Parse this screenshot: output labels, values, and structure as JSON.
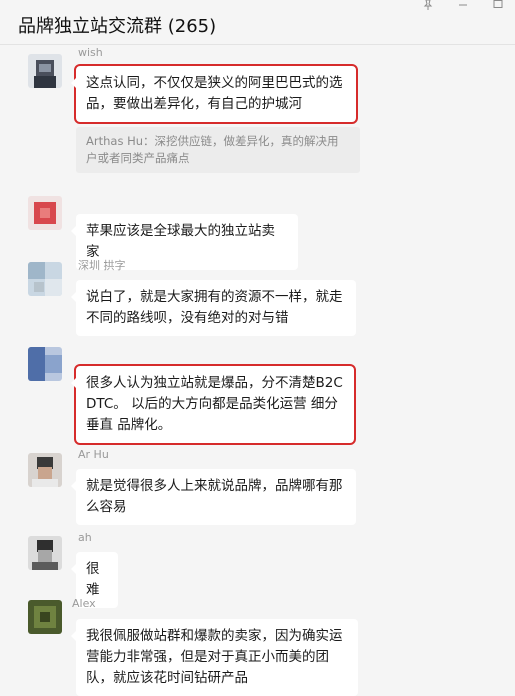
{
  "header": {
    "title": "品牌独立站交流群 (265)"
  },
  "window_controls": {
    "pin_icon": "pin-icon",
    "minimize_icon": "minimize-icon",
    "maximize_icon": "maximize-icon"
  },
  "messages": [
    {
      "sender": "wish",
      "text": "这点认同，不仅仅是狭义的阿里巴巴式的选品，要做出差异化，有自己的护城河",
      "highlighted": true,
      "quote": "Arthas Hu：深挖供应链，做差异化，真的解决用户或者同类产品痛点"
    },
    {
      "sender": "",
      "text": "苹果应该是全球最大的独立站卖家",
      "highlighted": false
    },
    {
      "sender": "深圳  拱字",
      "text": "说白了，就是大家拥有的资源不一样，就走不同的路线呗，没有绝对的对与错",
      "highlighted": false
    },
    {
      "sender": "",
      "text": "很多人认为独立站就是爆品，分不清楚B2C DTC。 以后的大方向都是品类化运营 细分垂直 品牌化。",
      "highlighted": true
    },
    {
      "sender": "Ar  Hu",
      "text": "就是觉得很多人上来就说品牌，品牌哪有那么容易",
      "highlighted": false
    },
    {
      "sender": "ah",
      "text": "很难",
      "highlighted": false
    },
    {
      "sender": "Alex",
      "text": "我很佩服做站群和爆款的卖家，因为确实运营能力非常强，但是对于真正小而美的团队，就应该花时间钻研产品",
      "highlighted": false
    }
  ],
  "colors": {
    "background": "#f5f5f5",
    "bubble": "#ffffff",
    "highlight_border": "#d62b2b",
    "name_text": "#9a9a9a",
    "quote_bg": "#ececec"
  }
}
